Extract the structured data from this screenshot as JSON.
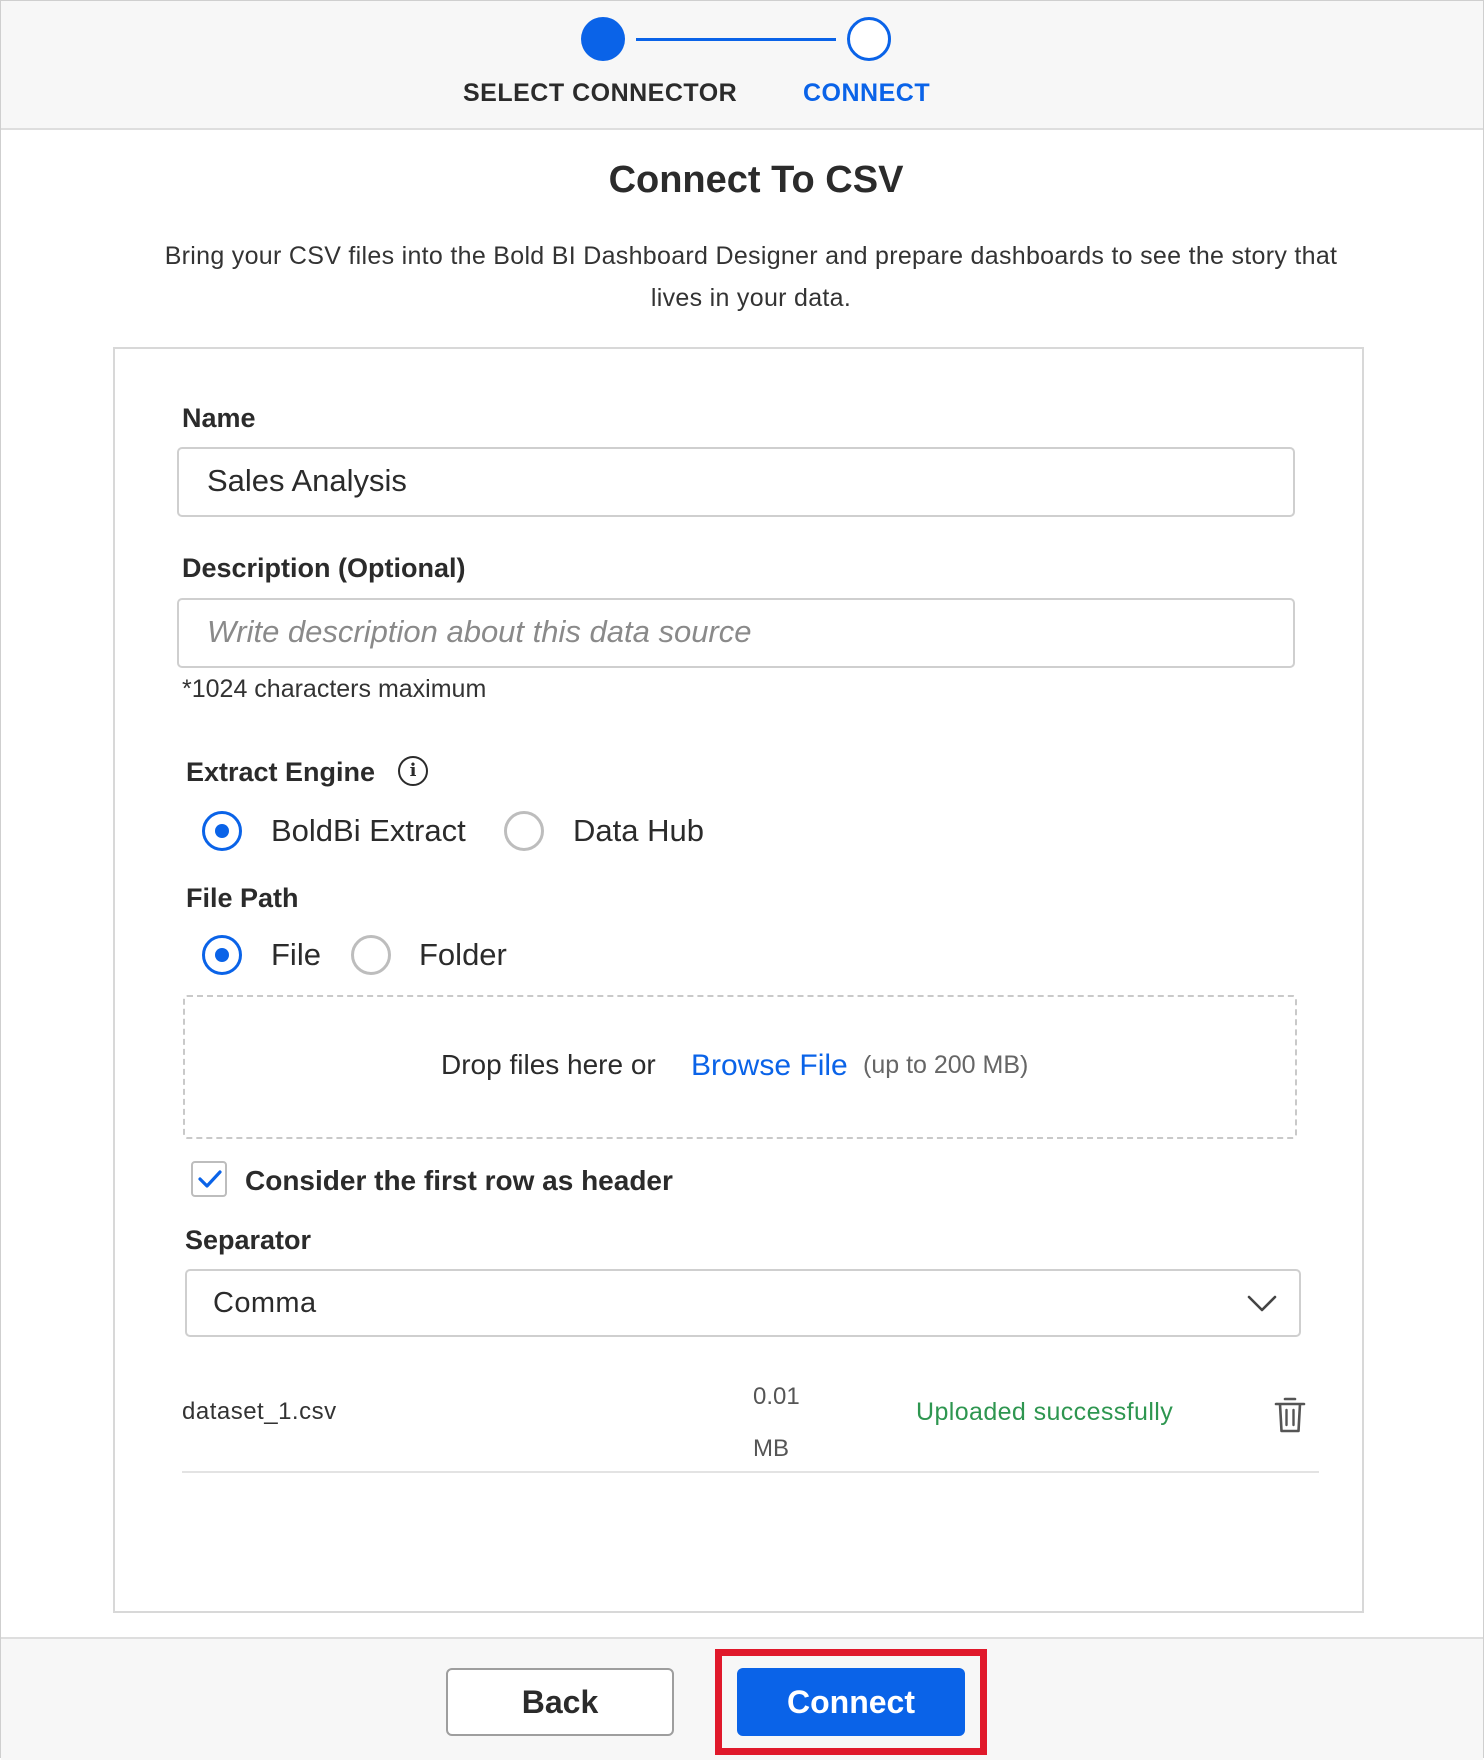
{
  "stepper": {
    "steps": [
      {
        "label": "SELECT CONNECTOR",
        "state": "done"
      },
      {
        "label": "CONNECT",
        "state": "active"
      }
    ]
  },
  "header": {
    "title": "Connect To CSV",
    "subtitle": "Bring your CSV files into the Bold BI Dashboard Designer and prepare dashboards to see the story that lives in your data."
  },
  "form": {
    "name": {
      "label": "Name",
      "value": "Sales Analysis"
    },
    "description": {
      "label": "Description (Optional)",
      "placeholder": "Write description about this data source",
      "hint": "*1024 characters maximum"
    },
    "extract_engine": {
      "label": "Extract Engine",
      "options": [
        {
          "label": "BoldBi Extract",
          "selected": true
        },
        {
          "label": "Data Hub",
          "selected": false
        }
      ]
    },
    "file_path": {
      "label": "File Path",
      "options": [
        {
          "label": "File",
          "selected": true
        },
        {
          "label": "Folder",
          "selected": false
        }
      ]
    },
    "dropzone": {
      "text": "Drop files here or",
      "browse_label": "Browse File",
      "limit": "(up to 200 MB)"
    },
    "header_checkbox": {
      "label": "Consider the first row as header",
      "checked": true
    },
    "separator": {
      "label": "Separator",
      "value": "Comma"
    },
    "uploaded_file": {
      "name": "dataset_1.csv",
      "size_value": "0.01",
      "size_unit": "MB",
      "status": "Uploaded successfully"
    }
  },
  "footer": {
    "back_label": "Back",
    "connect_label": "Connect"
  },
  "colors": {
    "accent": "#0a63e8",
    "success": "#2e9650",
    "highlight": "#e0192b"
  }
}
